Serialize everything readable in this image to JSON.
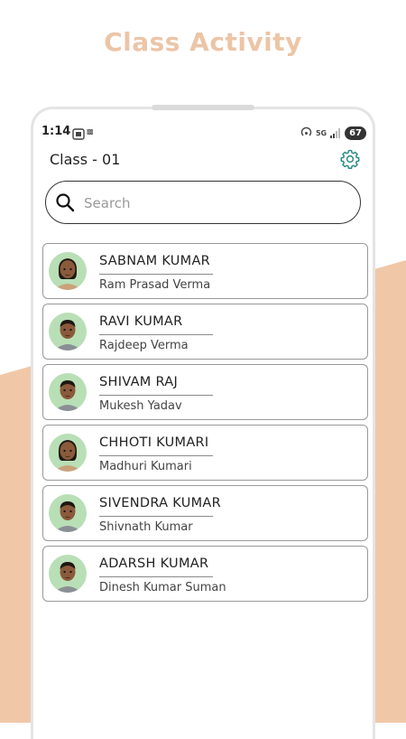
{
  "hero": {
    "title": "Class Activity"
  },
  "colors": {
    "accent": "#ecc5a7",
    "peach_bg": "#f0c8a8"
  },
  "status_bar": {
    "time": "1:14",
    "network_label": "5G",
    "battery": "67"
  },
  "header": {
    "class_title": "Class - 01"
  },
  "search": {
    "placeholder": "Search",
    "value": ""
  },
  "students": [
    {
      "name": "SABNAM KUMAR",
      "parent": "Ram Prasad Verma",
      "gender": "girl"
    },
    {
      "name": "RAVI KUMAR",
      "parent": "Rajdeep Verma",
      "gender": "boy"
    },
    {
      "name": "SHIVAM RAJ",
      "parent": "Mukesh Yadav",
      "gender": "boy"
    },
    {
      "name": "CHHOTI KUMARI",
      "parent": "Madhuri Kumari",
      "gender": "girl"
    },
    {
      "name": "SIVENDRA KUMAR",
      "parent": "Shivnath Kumar",
      "gender": "boy"
    },
    {
      "name": "ADARSH KUMAR",
      "parent": "Dinesh Kumar Suman",
      "gender": "boy"
    }
  ]
}
